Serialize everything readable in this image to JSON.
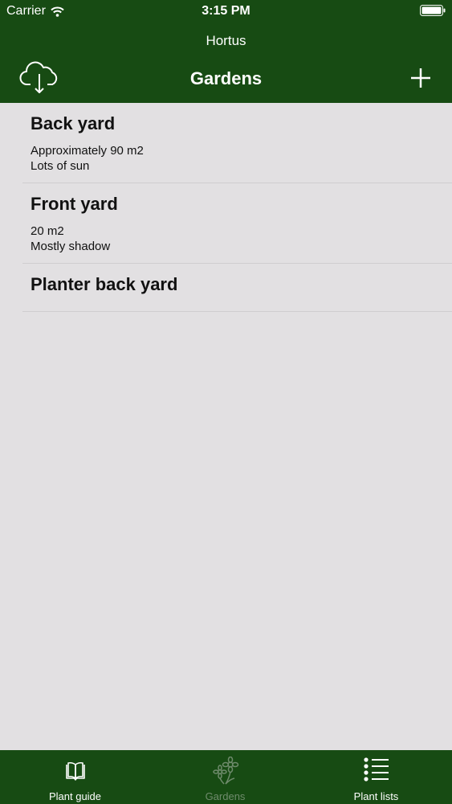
{
  "status_bar": {
    "carrier": "Carrier",
    "time": "3:15 PM"
  },
  "header": {
    "app_title": "Hortus",
    "nav_title": "Gardens",
    "left_icon": "cloud-download-icon",
    "right_icon": "plus-icon"
  },
  "gardens": [
    {
      "name": "Back yard",
      "line1": "Approximately 90 m2",
      "line2": "Lots of sun"
    },
    {
      "name": "Front yard",
      "line1": "20 m2",
      "line2": "Mostly shadow"
    },
    {
      "name": "Planter back yard"
    }
  ],
  "tabbar": {
    "tabs": [
      {
        "label": "Plant guide",
        "icon": "book-icon"
      },
      {
        "label": "Gardens",
        "icon": "flower-icon",
        "active": true
      },
      {
        "label": "Plant lists",
        "icon": "list-icon"
      }
    ]
  },
  "colors": {
    "brand_green": "#174b13",
    "background": "#e2e0e2",
    "inactive_tab": "#6f8b6c"
  }
}
